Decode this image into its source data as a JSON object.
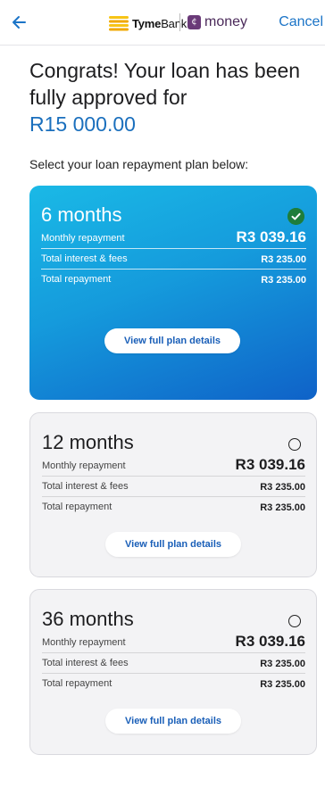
{
  "header": {
    "brand_name_bold": "Tyme",
    "brand_name_rest": "Bank",
    "partner_icon_glyph": "¢",
    "partner_name": "money",
    "cancel_label": "Cancel",
    "colors": {
      "accent": "#1b74c7",
      "partner": "#6a3a78"
    }
  },
  "headline": {
    "text": "Congrats! Your loan has been fully approved for",
    "amount": "R15 000.00"
  },
  "subtitle": "Select your loan repayment plan below:",
  "plans": [
    {
      "term": "6 months",
      "selected": true,
      "rows": [
        {
          "label": "Monthly repayment",
          "value": "R3 039.16"
        },
        {
          "label": "Total interest & fees",
          "value": "R3 235.00"
        },
        {
          "label": "Total repayment",
          "value": "R3 235.00"
        }
      ],
      "button_label": "View full plan details"
    },
    {
      "term": "12 months",
      "selected": false,
      "rows": [
        {
          "label": "Monthly repayment",
          "value": "R3 039.16"
        },
        {
          "label": "Total interest & fees",
          "value": "R3 235.00"
        },
        {
          "label": "Total repayment",
          "value": "R3 235.00"
        }
      ],
      "button_label": "View full plan details"
    },
    {
      "term": "36 months",
      "selected": false,
      "rows": [
        {
          "label": "Monthly repayment",
          "value": "R3 039.16"
        },
        {
          "label": "Total interest & fees",
          "value": "R3 235.00"
        },
        {
          "label": "Total repayment",
          "value": "R3 235.00"
        }
      ],
      "button_label": "View full plan details"
    }
  ]
}
